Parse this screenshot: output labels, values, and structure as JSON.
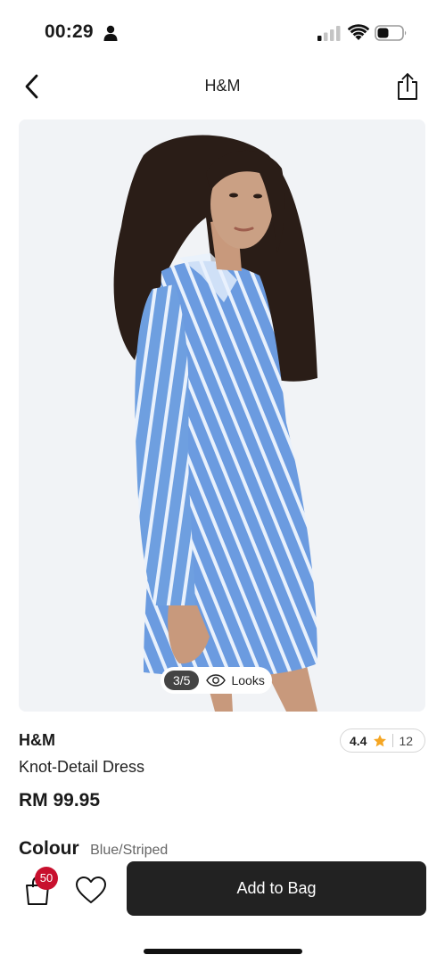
{
  "status_bar": {
    "time": "00:29"
  },
  "nav": {
    "title": "H&M"
  },
  "product": {
    "image_counter": "3/5",
    "looks_label": "Looks",
    "brand": "H&M",
    "name": "Knot-Detail Dress",
    "price": "RM 99.95",
    "rating": "4.4",
    "review_count": "12",
    "colour_label": "Colour",
    "colour_value": "Blue/Striped"
  },
  "bottom_bar": {
    "bag_count": "50",
    "add_to_bag_label": "Add to Bag"
  },
  "colors": {
    "dress_blue": "#6e9fe0",
    "star": "#f5a623",
    "badge_red": "#c8102e",
    "button_dark": "#222222"
  }
}
